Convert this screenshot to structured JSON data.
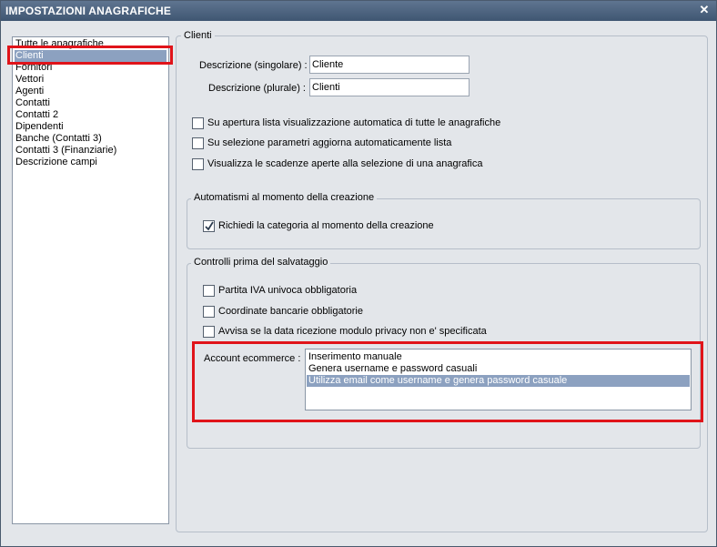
{
  "window": {
    "title": "IMPOSTAZIONI ANAGRAFICHE",
    "close_glyph": "✕"
  },
  "sidebar": {
    "items": [
      {
        "label": "Tutte le anagrafiche"
      },
      {
        "label": "Clienti",
        "selected": true
      },
      {
        "label": "Fornitori"
      },
      {
        "label": "Vettori"
      },
      {
        "label": "Agenti"
      },
      {
        "label": "Contatti"
      },
      {
        "label": "Contatti 2"
      },
      {
        "label": "Dipendenti"
      },
      {
        "label": "Banche (Contatti 3)"
      },
      {
        "label": "Contatti 3 (Finanziarie)"
      },
      {
        "label": "Descrizione campi"
      }
    ]
  },
  "main": {
    "group_title": "Clienti",
    "desc_singolare": {
      "label": "Descrizione (singolare) :",
      "value": "Cliente"
    },
    "desc_plurale": {
      "label": "Descrizione (plurale) :",
      "value": "Clienti"
    },
    "options": [
      {
        "label": "Su apertura lista visualizzazione automatica di tutte le anagrafiche",
        "checked": false
      },
      {
        "label": "Su selezione parametri aggiorna automaticamente lista",
        "checked": false
      },
      {
        "label": "Visualizza le scadenze aperte alla selezione di una anagrafica",
        "checked": false
      }
    ]
  },
  "automatismi": {
    "title": "Automatismi al momento della creazione",
    "options": [
      {
        "label": "Richiedi la categoria al momento della creazione",
        "checked": true
      }
    ]
  },
  "controlli": {
    "title": "Controlli prima del salvataggio",
    "options": [
      {
        "label": "Partita IVA univoca obbligatoria",
        "checked": false
      },
      {
        "label": "Coordinate bancarie obbligatorie",
        "checked": false
      },
      {
        "label": "Avvisa se la data ricezione modulo privacy non e' specificata",
        "checked": false
      }
    ],
    "account_label": "Account ecommerce :",
    "account_options": [
      {
        "label": "Inserimento manuale"
      },
      {
        "label": "Genera username e password casuali"
      },
      {
        "label": "Utilizza email come username e genera password casuale",
        "selected": true
      }
    ]
  },
  "colors": {
    "highlight": "#e0141a",
    "selection": "#8ca1c0",
    "titlebar": "#4a6180"
  }
}
